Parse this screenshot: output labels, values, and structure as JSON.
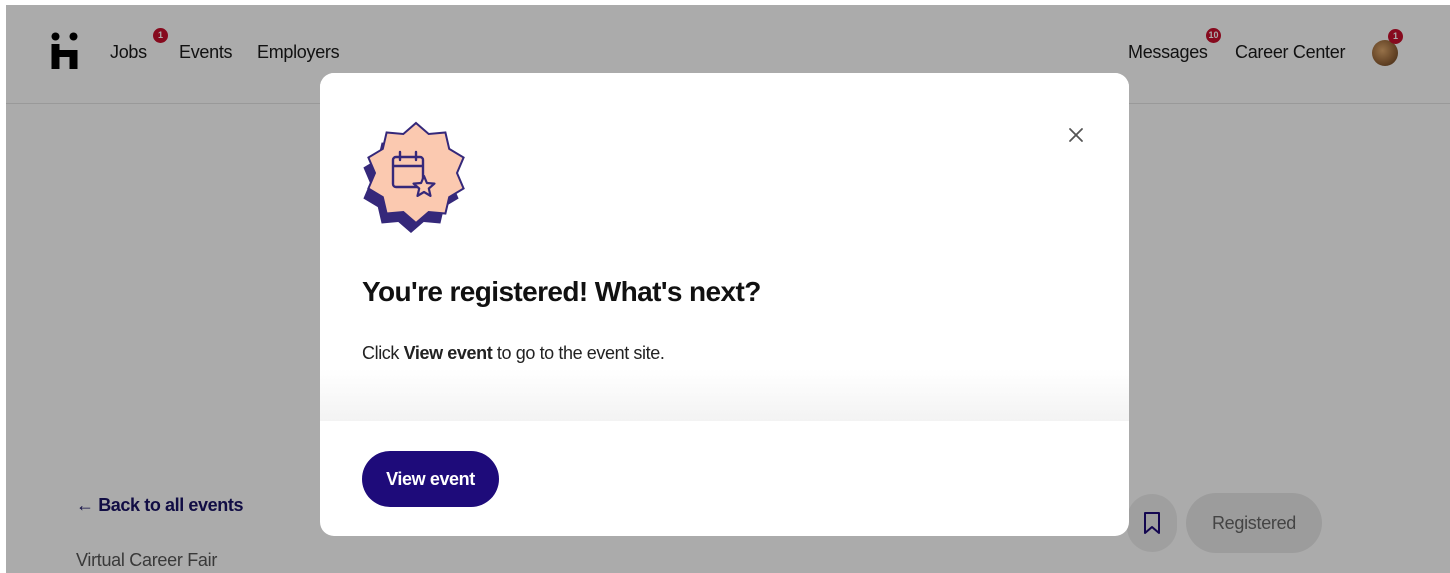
{
  "nav": {
    "jobs_label": "Jobs",
    "jobs_badge": "1",
    "events_label": "Events",
    "employers_label": "Employers",
    "messages_label": "Messages",
    "messages_badge": "10",
    "career_center_label": "Career Center",
    "avatar_badge": "1"
  },
  "event_page": {
    "back_link": "← Back to all events",
    "event_type": "Virtual Career Fair",
    "registered_label": "Registered"
  },
  "modal": {
    "title": "You're registered! What's next?",
    "text_prefix": "Click ",
    "text_bold": "View event",
    "text_suffix": " to go to the event site.",
    "button_label": "View event",
    "close_symbol": "×"
  },
  "colors": {
    "brand_dark": "#1e0b7a",
    "badge_red": "#c8102e",
    "illustration_fill": "#fbc9b0",
    "illustration_shadow": "#35287a"
  },
  "icons": [
    "handshake-logo-icon",
    "close-icon",
    "calendar-star-icon",
    "bookmark-icon"
  ]
}
